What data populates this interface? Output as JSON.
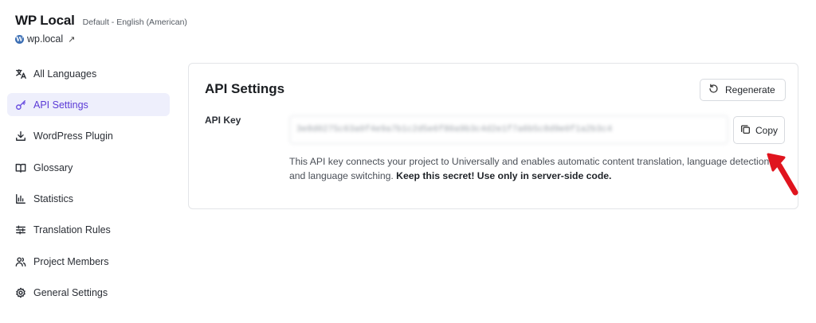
{
  "site": {
    "title": "WP Local",
    "locale": "Default - English (American)",
    "url": "wp.local",
    "url_icon": "external-link-icon"
  },
  "sidebar": {
    "items": [
      {
        "label": "All Languages",
        "icon": "translate-icon",
        "active": false
      },
      {
        "label": "API Settings",
        "icon": "key-icon",
        "active": true
      },
      {
        "label": "WordPress Plugin",
        "icon": "download-icon",
        "active": false
      },
      {
        "label": "Glossary",
        "icon": "book-icon",
        "active": false
      },
      {
        "label": "Statistics",
        "icon": "bar-chart-icon",
        "active": false
      },
      {
        "label": "Translation Rules",
        "icon": "sliders-icon",
        "active": false
      },
      {
        "label": "Project Members",
        "icon": "users-icon",
        "active": false
      },
      {
        "label": "General Settings",
        "icon": "gear-icon",
        "active": false
      }
    ]
  },
  "api_settings": {
    "title": "API Settings",
    "regenerate_label": "Regenerate",
    "api_key_label": "API Key",
    "api_key_value": "3e8d0275c63a0f4e9a7b1c2d5e6f80a9b3c4d2e1f7a6b5c8d9e0f1a2b3c4",
    "copy_label": "Copy",
    "help_text": "This API key connects your project to Universally and enables automatic content translation, language detection, and language switching.",
    "help_text_bold": "Keep this secret! Use only in server-side code."
  },
  "colors": {
    "accent": "#5b3ad6",
    "active_bg": "#eeeffc",
    "annotation_arrow": "#e0141e"
  }
}
